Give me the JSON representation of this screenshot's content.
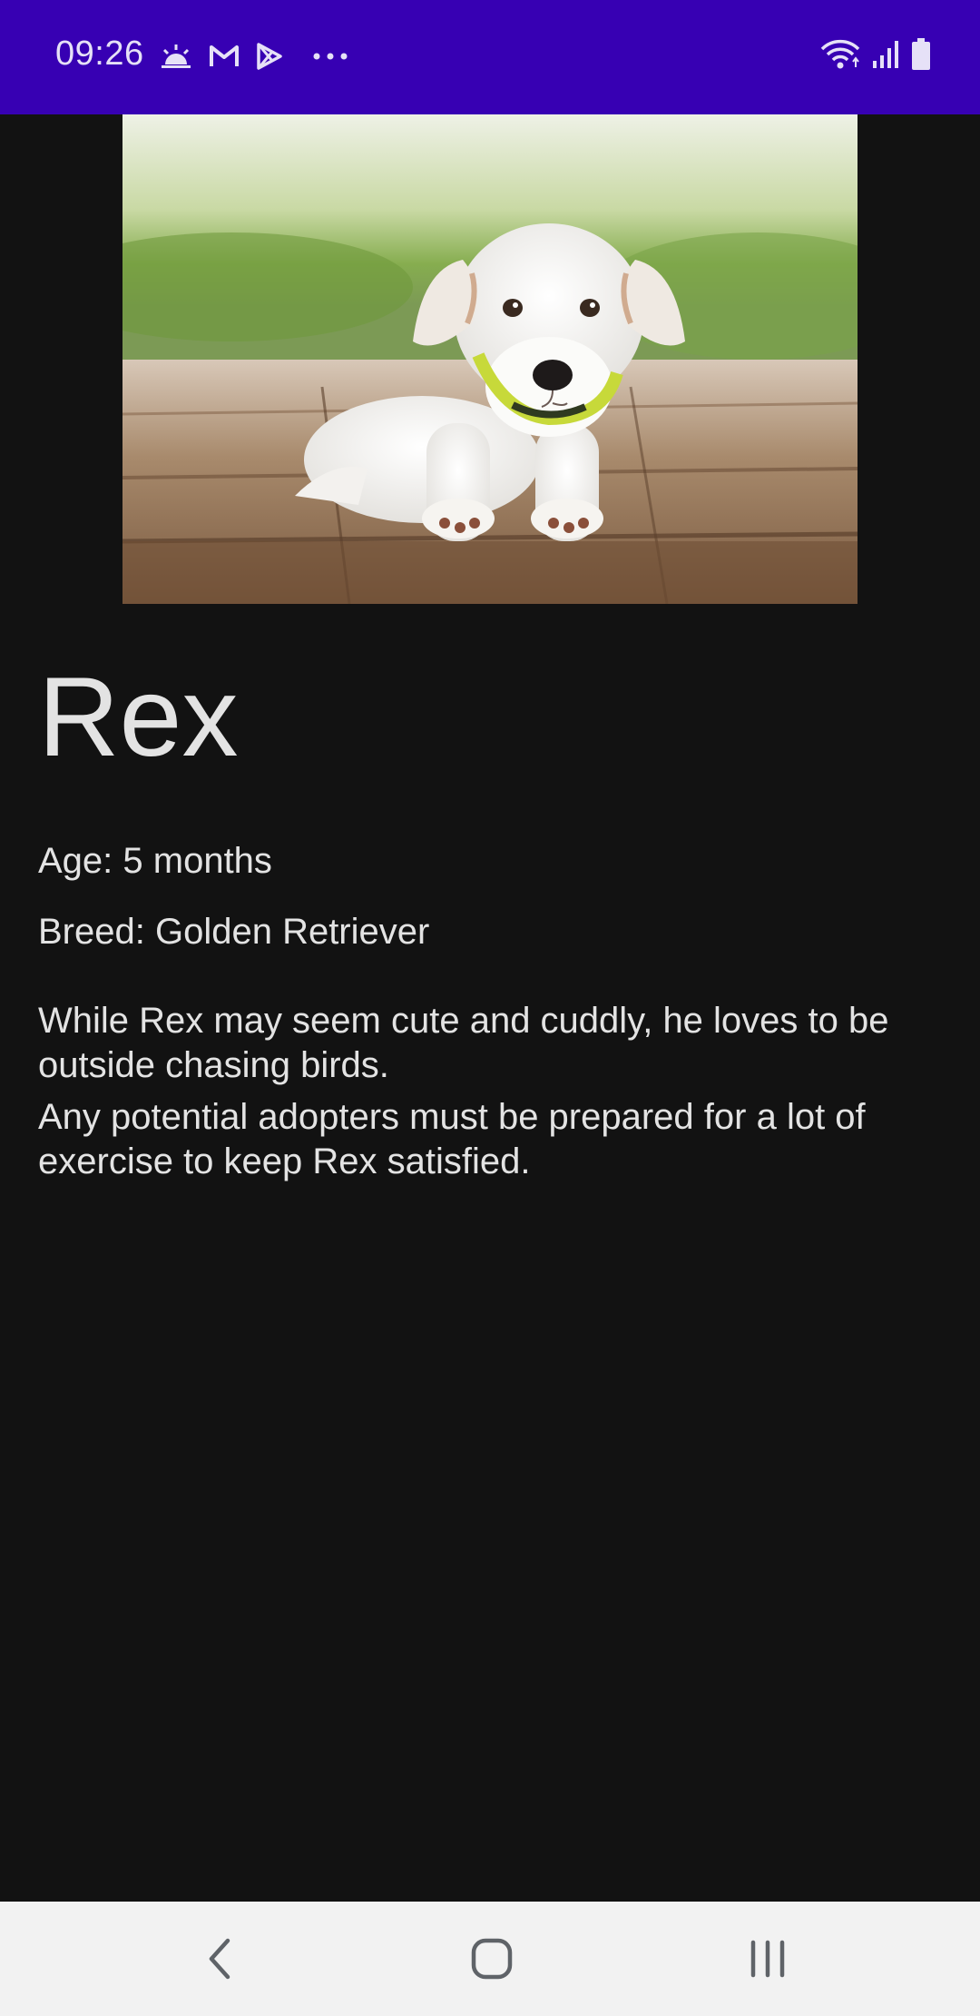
{
  "status_bar": {
    "time": "09:26",
    "left_icons": [
      "weather-sunrise-icon",
      "gmail-icon",
      "play-store-icon",
      "more-dots-icon"
    ],
    "right_icons": [
      "wifi-icon",
      "cell-signal-icon",
      "battery-icon"
    ],
    "background_color": "#3700B3"
  },
  "hero_image": {
    "subject": "white puppy lying on wooden deck"
  },
  "dog": {
    "name": "Rex",
    "age": "Age: 5 months",
    "breed": "Breed: Golden Retriever",
    "description_line1": "While Rex may seem cute and cuddly, he loves to be outside chasing birds.",
    "description_line2": "Any potential adopters must be prepared for a lot of exercise to keep Rex satisfied."
  },
  "nav_bar": {
    "buttons": [
      "back-icon",
      "home-icon",
      "recents-icon"
    ]
  },
  "colors": {
    "background": "#121212",
    "text": "#e3e3e3",
    "nav_background": "#f2f2f2"
  }
}
